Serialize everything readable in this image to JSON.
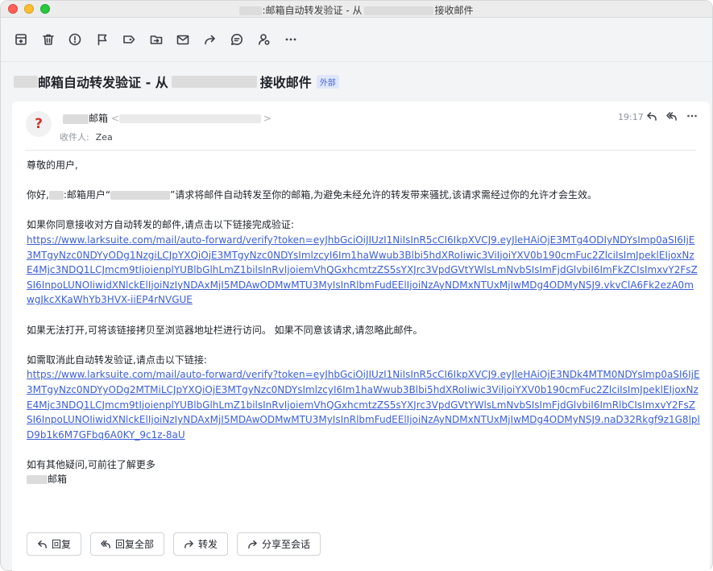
{
  "window": {
    "title_suffix": ":邮箱自动转发验证 - 从",
    "title_end": "接收邮件"
  },
  "toolbar": {
    "items": [
      {
        "name": "archive-icon"
      },
      {
        "name": "trash-icon"
      },
      {
        "name": "spam-icon"
      },
      {
        "name": "flag-icon"
      },
      {
        "name": "label-icon"
      },
      {
        "name": "move-folder-icon"
      },
      {
        "name": "mark-unread-icon"
      },
      {
        "name": "forward-share-icon"
      },
      {
        "name": "comment-icon"
      },
      {
        "name": "contact-icon"
      },
      {
        "name": "more-icon"
      }
    ]
  },
  "subject": {
    "middle": "邮箱自动转发验证 - 从",
    "end": "接收邮件",
    "badge": "外部"
  },
  "message": {
    "avatar_glyph": "?",
    "sender_name": "邮箱",
    "sender_addr_open": "<",
    "sender_addr_close": ">",
    "recipient_label": "收件人:",
    "recipient_name": "Zea",
    "time": "19:17",
    "greeting": "尊敬的用户,",
    "para1_a": "你好,",
    "para1_b": ":邮箱用户“",
    "para1_c": "”请求将邮件自动转发至你的邮箱,为避免未经允许的转发带来骚扰,该请求需经过你的允许才会生效。",
    "para2": "如果你同意接收对方自动转发的邮件,请点击以下链接完成验证:",
    "link1": "https://www.larksuite.com/mail/auto-forward/verify?token=eyJhbGciOiJIUzI1NiIsInR5cCI6IkpXVCJ9.eyJleHAiOjE3MTg4ODIyNDYsImp0aSI6IjE3MTgyNzc0NDYyODg1NzgiLCJpYXQiOjE3MTgyNzc0NDYsImlzcyI6Im1haWwub3Blbi5hdXRoIiwic3ViIjoiYXV0b190cmFuc2ZlciIsImJpeklEIjoxNzE4Mjc3NDQ1LCJmcm9tIjoienplYUBlbGlhLmZ1bilsInRvIjoiemVhQGxhcmtzZS5sYXJrc3VpdGVtYWlsLmNvbSIsImFjdGlvbiI6ImFkZCIsImxvY2FsZSI6InpoLUNOIiwidXNlckElIjoiNzIyNDAxMjI5MDAwODMwMTU3MyIsInRlbmFudEElIjoiNzAyNDMxNTUxMjIwMDg4ODMyNSJ9.vkvClA6Fk2ezA0mwgJkcXKaWhYb3HVX-iiEP4rNVGUE",
    "para3": "如果无法打开,可将该链接拷贝至浏览器地址栏进行访问。 如果不同意该请求,请忽略此邮件。",
    "para4": "如需取消此自动转发验证,请点击以下链接:",
    "link2": "https://www.larksuite.com/mail/auto-forward/verify?token=eyJhbGciOiJIUzI1NiIsInR5cCI6IkpXVCJ9.eyJleHAiOjE3NDk4MTM0NDYsImp0aSI6IjE3MTgyNzc0NDYyODg2MTMiLCJpYXQiOjE3MTgyNzc0NDYsImlzcyI6Im1haWwub3Blbi5hdXRoIiwic3ViIjoiYXV0b190cmFuc2ZlciIsImJpeklEIjoxNzE4Mjc3NDQ1LCJmcm9tIjoienplYUBlbGlhLmZ1bilsInRvIjoiemVhQGxhcmtzZS5sYXJrc3VpdGVtYWlsLmNvbSIsImFjdGlvbiI6ImRlbCIsImxvY2FsZSI6InpoLUNOIiwidXNlckElIjoiNzIyNDAxMjI5MDAwODMwMTU3MyIsInRlbmFudEElIjoiNzAyNDMxNTUxMjIwMDg4ODMyNSJ9.naD32Rkgf9z1G8lplD9b1k6M7GFbq6A0KY_9c1z-8aU",
    "para5": "如有其他疑问,可前往了解更多",
    "signoff": "邮箱"
  },
  "reply_bar": {
    "reply": "回复",
    "reply_all": "回复全部",
    "forward": "转发",
    "share": "分享至会话"
  }
}
